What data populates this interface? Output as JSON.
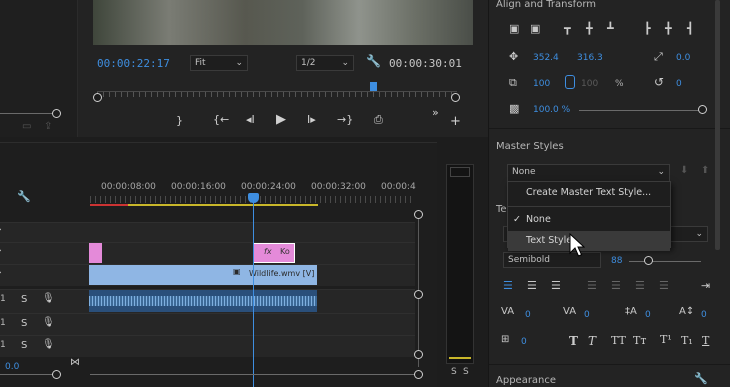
{
  "monitor": {
    "current_timecode": "00:00:22:17",
    "fit_select": "Fit",
    "resolution_select": "1/2",
    "duration_timecode": "00:00:30:01"
  },
  "timeline": {
    "ruler_labels": [
      "00:00:08:00",
      "00:00:16:00",
      "00:00:24:00",
      "00:00:32:00",
      "00:00:4"
    ],
    "clip_video_label": "Wildlife.wmv [V]",
    "graphic_fx_label": "fx",
    "graphic_ko_label": "Ko",
    "audio_track_letter": "S",
    "meter_solo_labels": [
      "S",
      "S"
    ],
    "bottom_value": "0.0"
  },
  "essential_graphics": {
    "align_title": "Align and Transform",
    "position_x": "352.4",
    "position_y": "316.3",
    "anchor_value": "0.0",
    "scale_w": "100",
    "scale_h": "100",
    "scale_unit": "%",
    "rotation_value": "0",
    "opacity_value": "100.0 %",
    "master_styles_title": "Master Styles",
    "master_styles_value": "None",
    "text_section_title": "Te",
    "font_style": "Semibold",
    "font_size": "88",
    "tracking_value": "0",
    "kerning_value": "0",
    "leading_value": "0",
    "baseline_value": "0",
    "tsume_value": "0",
    "appearance_title": "Appearance"
  },
  "master_styles_menu": {
    "items": [
      "Create Master Text Style...",
      "None",
      "Text Style"
    ],
    "checked_index": 1,
    "highlighted_index": 2
  }
}
